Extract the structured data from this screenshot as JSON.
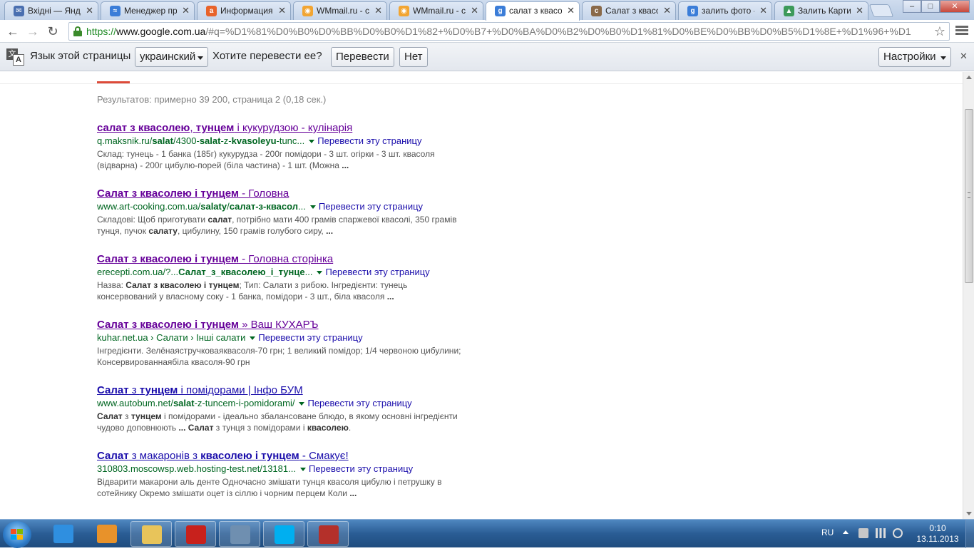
{
  "tabs": [
    {
      "label": "Вхідні — Яндекс",
      "icon": "mail-icon",
      "color": "#4a6fb0",
      "glyph": "✉"
    },
    {
      "label": "Менеджер про",
      "icon": "chart-icon",
      "color": "#3b7dd8",
      "glyph": "≈"
    },
    {
      "label": "Информация",
      "icon": "avast-icon",
      "color": "#e8632a",
      "glyph": "a"
    },
    {
      "label": "WMmail.ru - ст",
      "icon": "wmmail-icon",
      "color": "#f2a532",
      "glyph": "◉"
    },
    {
      "label": "WMmail.ru - ст",
      "icon": "wmmail-icon",
      "color": "#f2a532",
      "glyph": "◉"
    },
    {
      "label": "салат з квасол",
      "icon": "google-icon",
      "color": "#3b7dd8",
      "glyph": "g",
      "active": true
    },
    {
      "label": "Салат з квасол",
      "icon": "cooking-icon",
      "color": "#8a6a4a",
      "glyph": "c"
    },
    {
      "label": "залить фото -",
      "icon": "google-icon",
      "color": "#3b7dd8",
      "glyph": "g"
    },
    {
      "label": "Залить Картин",
      "icon": "image-icon",
      "color": "#3c9a5a",
      "glyph": "▲"
    }
  ],
  "window": {
    "minimize": "–",
    "maximize": "□",
    "close": "✕"
  },
  "toolbar": {
    "back": "←",
    "forward": "→",
    "reload": "↻",
    "url_scheme": "https://",
    "url_host": "www.google.com.ua",
    "url_rest": "/#q=%D1%81%D0%B0%D0%BB%D0%B0%D1%82+%D0%B7+%D0%BA%D0%B2%D0%B0%D1%81%D0%BE%D0%BB%D0%B5%D1%8E+%D1%96+%D1",
    "star": "☆"
  },
  "translate_bar": {
    "page_language_label": "Язык этой страницы",
    "language_value": "украинский",
    "question": "Хотите перевести ее?",
    "translate_button": "Перевести",
    "no_button": "Нет",
    "settings_button": "Настройки",
    "close": "✕",
    "icon_a": "文",
    "icon_b": "A"
  },
  "results_stats": "Результатов: примерно 39 200, страница 2 (0,18 сек.)",
  "results": [
    {
      "visited": true,
      "title_html": "<b>салат з квасолею</b>, <b>тунцем</b> і кукурудзою - кулінарія",
      "cite_html": "q.maksnik.ru/<b>salat</b>/4300-<b>salat</b>-z-<b>kvasoleyu</b>-tunc...",
      "translate": "Перевести эту страницу",
      "snippet_html": "Склад: тунець - 1 банка (185г) кукурудза - 200г помідори - 3 шт. огірки - 3 шт. квасоля (відварна) - 200г цибулю-порей (біла частина) - 1 шт. (Можна <b>...</b>"
    },
    {
      "visited": true,
      "title_html": "<b>Салат з квасолею і тунцем</b> - Головна",
      "cite_html": "www.art-cooking.com.ua/<b>salaty</b>/<b>салат-з-квасол</b>...",
      "translate": "Перевести эту страницу",
      "snippet_html": "Складові: Щоб приготувати <b>салат</b>, потрібно мати 400 грамів спаржевої квасолі, 350 грамів тунця, пучок <b>салату</b>, цибулину, 150 грамів голубого сиру, <b>...</b>"
    },
    {
      "visited": true,
      "title_html": "<b>Салат з квасолею і тунцем</b> - Головна сторінка",
      "cite_html": "erecepti.com.ua/?...<b>Салат_з_квасолею_і_тунце</b>...",
      "translate": "Перевести эту страницу",
      "snippet_html": "Назва: <b>Салат з квасолею і тунцем</b>; Тип: Салати з рибою. Інгредієнти: тунець консервований у власному соку - 1 банка, помідори - 3 шт., біла квасоля <b>...</b>"
    },
    {
      "visited": true,
      "title_html": "<b>Салат з квасолею і тунцем</b> » Ваш КУХАРЪ",
      "cite_html": "kuhar.net.ua › Салати › Інші салати",
      "translate": "Перевести эту страницу",
      "snippet_html": "Інгредієнти. Зелёнаястручковаяквасоля-70 грн; 1 великий помідор; 1/4 червоною цибулини; Консервированнаябіла квасоля-90 грн"
    },
    {
      "visited": false,
      "title_html": "<b>Салат</b> з <b>тунцем</b> і помідорами | Інфо БУМ",
      "cite_html": "www.autobum.net/<b>salat</b>-z-tuncem-i-pomidorami/",
      "translate": "Перевести эту страницу",
      "snippet_html": "<b>Салат</b> з <b>тунцем</b> і помідорами - ідеально збалансоване блюдо, в якому основні інгредієнти чудово доповнюють <b>... Салат</b> з тунця з помідорами і <b>квасолею</b>."
    },
    {
      "visited": false,
      "title_html": "<b>Салат</b> з макаронів з <b>квасолею і тунцем</b> - Смакує!",
      "cite_html": "310803.moscowsp.web.hosting-test.net/13181...",
      "translate": "Перевести эту страницу",
      "snippet_html": "Відварити макарони аль денте Одночасно змішати тунця квасоля цибулю і петрушку в сотейнику Окремо змішати оцет із сіллю і чорним перцем Коли <b>...</b>"
    }
  ],
  "taskbar": {
    "apps": [
      {
        "name": "ie-icon",
        "color": "#2f8fe0"
      },
      {
        "name": "media-player-icon",
        "color": "#e8922a"
      },
      {
        "name": "folder-icon",
        "color": "#e8c45a"
      },
      {
        "name": "pdf-icon",
        "color": "#c8211c"
      },
      {
        "name": "window-app-icon",
        "color": "#6f8fb0"
      },
      {
        "name": "skype-icon",
        "color": "#00aff0"
      },
      {
        "name": "graph-app-icon",
        "color": "#b4302a"
      }
    ],
    "language": "RU",
    "time": "0:10",
    "date": "13.11.2013"
  }
}
